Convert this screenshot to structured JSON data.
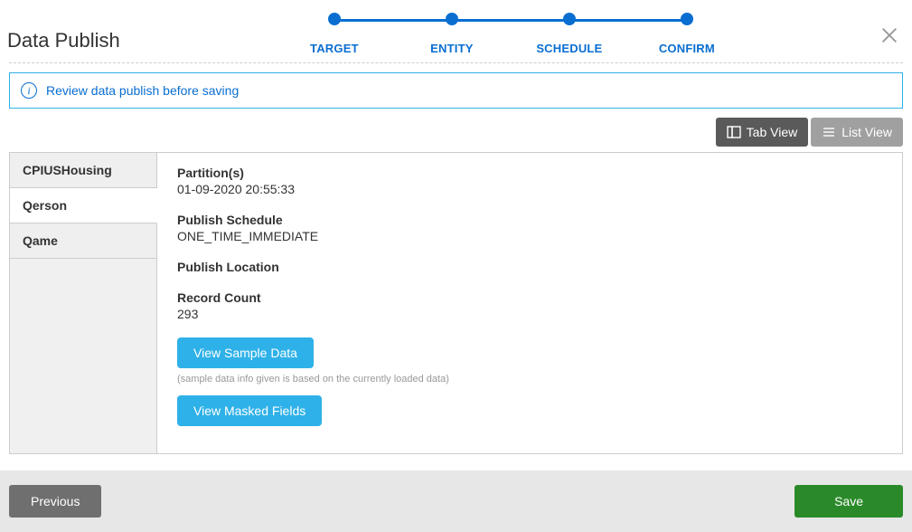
{
  "header": {
    "title": "Data Publish"
  },
  "stepper": {
    "steps": [
      "TARGET",
      "ENTITY",
      "SCHEDULE",
      "CONFIRM"
    ]
  },
  "info": {
    "message": "Review data publish before saving"
  },
  "view_toggle": {
    "tab": "Tab View",
    "list": "List View"
  },
  "sidebar": {
    "items": [
      "CPIUSHousing",
      "Qerson",
      "Qame"
    ],
    "active_index": 1
  },
  "details": {
    "partitions_label": "Partition(s)",
    "partitions_value": "01-09-2020 20:55:33",
    "schedule_label": "Publish Schedule",
    "schedule_value": "ONE_TIME_IMMEDIATE",
    "location_label": "Publish Location",
    "location_value": "",
    "record_count_label": "Record Count",
    "record_count_value": "293",
    "view_sample_label": "View Sample Data",
    "sample_hint": "(sample data info given is based on the currently loaded data)",
    "view_masked_label": "View Masked Fields"
  },
  "footer": {
    "previous": "Previous",
    "save": "Save"
  }
}
